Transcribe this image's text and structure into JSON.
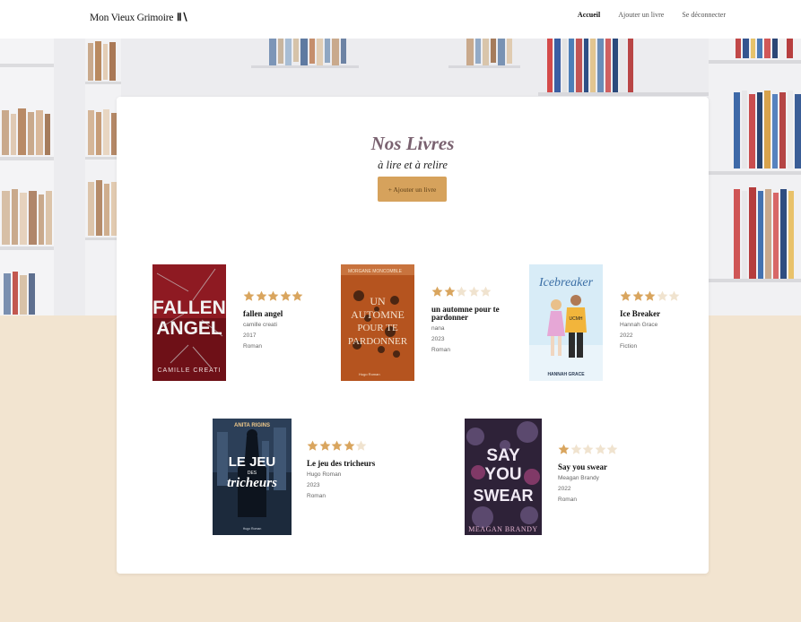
{
  "header": {
    "logo_text": "Mon Vieux Grimoire",
    "logo_mark": "Ⅱ\\",
    "nav": [
      {
        "label": "Accueil",
        "active": true
      },
      {
        "label": "Ajouter un livre",
        "active": false
      },
      {
        "label": "Se déconnecter",
        "active": false
      }
    ]
  },
  "main": {
    "title": "Nos Livres",
    "subtitle": "à lire et à relire",
    "add_button_label": "+ Ajouter un livre"
  },
  "colors": {
    "accent": "#d6a25c",
    "star_filled": "#d9a55e",
    "star_empty": "#f0e3cf",
    "page_bg": "#f2e4d0"
  },
  "books": [
    {
      "title": "fallen angel",
      "author": "camille creati",
      "year": "2017",
      "genre": "Roman",
      "rating": 5,
      "cover": {
        "text_main": "FALLEN ANGEL",
        "text_author": "CAMILLE CREATI",
        "bg": "#8e1a22"
      }
    },
    {
      "title": "un automne pour te pardonner",
      "author": "nana",
      "year": "2023",
      "genre": "Roman",
      "rating": 2,
      "cover": {
        "text_main": "UN AUTOMNE POUR TE PARDONNER",
        "text_author": "MORGANE MONCOMBLE",
        "bg": "#b5541f"
      }
    },
    {
      "title": "Ice Breaker",
      "author": "Hannah Grace",
      "year": "2022",
      "genre": "Fiction",
      "rating": 3,
      "cover": {
        "text_main": "Icebreaker",
        "text_author": "HANNAH GRACE",
        "bg": "#cfe6f3"
      }
    },
    {
      "title": "Le jeu des tricheurs",
      "author": "Hugo Roman",
      "year": "2023",
      "genre": "Roman",
      "rating": 4,
      "cover": {
        "text_main": "LE JEU DES tricheurs",
        "text_author": "ANITA RIGINS",
        "bg": "#1c2a3c"
      }
    },
    {
      "title": "Say you swear",
      "author": "Meagan Brandy",
      "year": "2022",
      "genre": "Roman",
      "rating": 1,
      "cover": {
        "text_main": "SAY YOU SWEAR",
        "text_author": "MEAGAN BRANDY",
        "bg": "#3a2a4a"
      }
    }
  ]
}
